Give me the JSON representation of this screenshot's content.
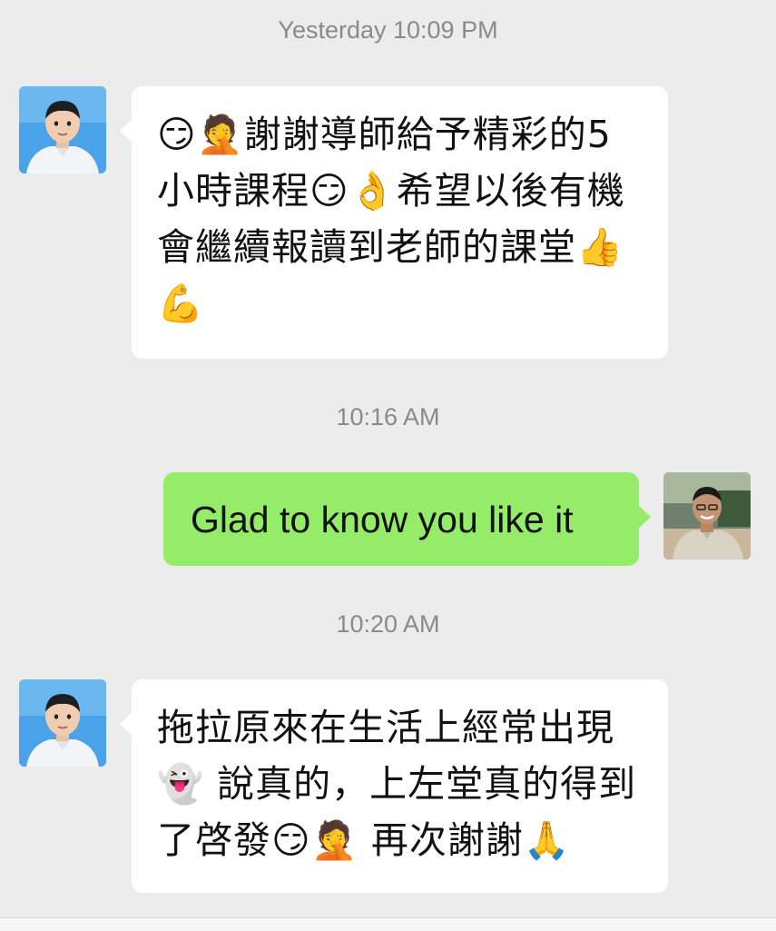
{
  "chat": {
    "timestamps": [
      "Yesterday 10:09 PM",
      "10:16 AM",
      "10:20 AM"
    ],
    "messages": [
      {
        "sender": "other",
        "text": "😏🤦謝謝導師給予精彩的5小時課程😏👌希望以後有機會繼續報讀到老師的課堂👍💪"
      },
      {
        "sender": "me",
        "text": "Glad to know you like it"
      },
      {
        "sender": "other",
        "text": "拖拉原來在生活上經常出現👻 說真的，上左堂真的得到了啓發😏🤦 再次謝謝🙏"
      }
    ]
  },
  "colors": {
    "background": "#ececec",
    "incoming_bubble": "#ffffff",
    "outgoing_bubble": "#95ec69",
    "timestamp_text": "#8a8a8a"
  },
  "icons": {
    "other_avatar": "child-portrait-avatar",
    "my_avatar": "man-portrait-avatar"
  }
}
